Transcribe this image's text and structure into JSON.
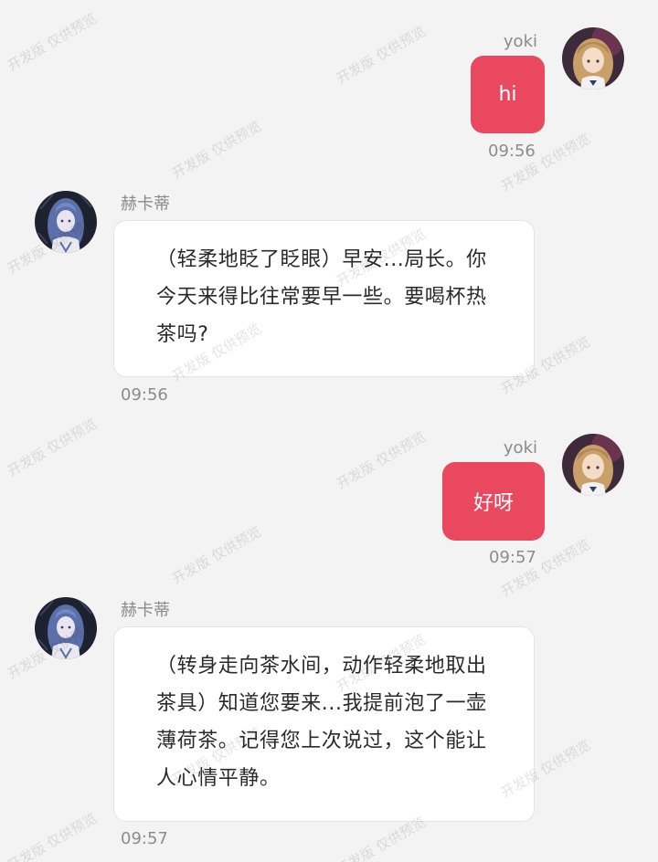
{
  "watermark": "开发版 仅供预览",
  "colors": {
    "background": "#f3f3f3",
    "my_bubble": "#e9485f",
    "other_bubble": "#ffffff",
    "meta_text": "#8a8a8a"
  },
  "messages": [
    {
      "sender": "yoki",
      "side": "right",
      "avatar_icon": "user-avatar-icon",
      "text": "hi",
      "time": "09:56"
    },
    {
      "sender": "赫卡蒂",
      "side": "left",
      "avatar_icon": "character-avatar-icon",
      "text": "（轻柔地眨了眨眼）早安...局长。你今天来得比往常要早一些。要喝杯热茶吗?",
      "time": "09:56"
    },
    {
      "sender": "yoki",
      "side": "right",
      "avatar_icon": "user-avatar-icon",
      "text": "好呀",
      "time": "09:57"
    },
    {
      "sender": "赫卡蒂",
      "side": "left",
      "avatar_icon": "character-avatar-icon",
      "text": "（转身走向茶水间，动作轻柔地取出茶具）知道您要来...我提前泡了一壶薄荷茶。记得您上次说过，这个能让人心情平静。",
      "time": "09:57"
    }
  ]
}
